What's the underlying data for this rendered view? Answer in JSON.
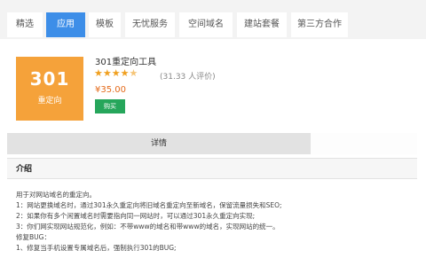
{
  "tabs": [
    {
      "label": "精选",
      "active": false
    },
    {
      "label": "应用",
      "active": true
    },
    {
      "label": "模板",
      "active": false
    },
    {
      "label": "无忧服务",
      "active": false
    },
    {
      "label": "空间域名",
      "active": false
    },
    {
      "label": "建站套餐",
      "active": false
    },
    {
      "label": "第三方合作",
      "active": false
    }
  ],
  "product": {
    "icon_text": "301",
    "icon_subtext": "重定向",
    "title": "301重定向工具",
    "rating_stars": 4.5,
    "rating_max": 5,
    "reviews": "(31.33 人评价)",
    "price": "¥35.00",
    "buy_label": "购买"
  },
  "detail_tab": "详情",
  "section_title": "介绍",
  "content_lines": [
    "用于对网站域名的重定向。",
    "1：网站更换域名时，通过301永久重定向将旧域名重定向至新域名，保留流量损失和SEO;",
    "2：如果你有多个闲置域名时需要指向同一网站时，可以通过301永久重定向实现;",
    "3：你们网实现网站规范化，例如：不带www的域名和带www的域名，实现网站的统一。",
    "修复BUG：",
    "1、修复当手机设置专属域名后，强制执行301的BUG;"
  ],
  "colors": {
    "accent": "#3d8ee8",
    "icon_bg": "#f5a23a",
    "star": "#f0a020",
    "price": "#e46a1a",
    "buy": "#26a65b"
  }
}
